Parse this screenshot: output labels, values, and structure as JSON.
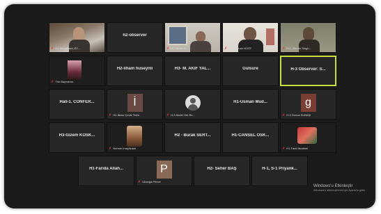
{
  "colors": {
    "background": "#1b1b1b",
    "tile": "#262626",
    "active_border": "#c8de3a",
    "mic_muted": "#e03a3a"
  },
  "rows": [
    [
      {
        "name": "",
        "footer": "H1-Mozaffarov-EY..."
      },
      {
        "name": "h2-observer",
        "footer": ""
      },
      {
        "name": "",
        "footer": "H2-Nilüfer Er..."
      },
      {
        "name": "",
        "footer": "Conference HOST"
      },
      {
        "name": "",
        "footer": "H-2_Vikram Singh..."
      }
    ],
    [
      {
        "name": "",
        "footer": "The Baynamor"
      },
      {
        "name": "H2-ilham huseynli",
        "footer": ""
      },
      {
        "name": "H3- M. AKİF YAL...",
        "footer": ""
      },
      {
        "name": "Gulsure",
        "footer": ""
      },
      {
        "name": "H-3 Observer: S...",
        "footer": ""
      }
    ],
    [
      {
        "name": "Hall-1. CONFER...",
        "footer": ""
      },
      {
        "name": "",
        "footer": "H2-İlknur Çevik Tekin",
        "initial": "İ"
      },
      {
        "name": "",
        "footer": "H-3 Abdel Gül Öz..."
      },
      {
        "name": "H1-Usman Mud...",
        "footer": ""
      },
      {
        "name": "",
        "footer": "H-3 Gonca SUBAŞI",
        "initial": "g"
      }
    ],
    [
      {
        "name": "H3-Gizem KÖSK...",
        "footer": ""
      },
      {
        "name": "",
        "footer": "Nermin İmaylizade"
      },
      {
        "name": "H2 - Burak SERT...",
        "footer": ""
      },
      {
        "name": "H1-CANSEL OSK...",
        "footer": ""
      },
      {
        "name": "",
        "footer": "H1-Farid İbrahimi"
      }
    ],
    [
      {
        "name": "H1-Farida Allah...",
        "footer": ""
      },
      {
        "name": "",
        "footer": "Ubaoga Prince",
        "initial": "P"
      },
      {
        "name": "H2- Seher BAŞ",
        "footer": ""
      },
      {
        "name": "H-1, S-1 Priyank...",
        "footer": ""
      }
    ]
  ],
  "watermark": {
    "title": "Windows'u Etkinleştir",
    "subtitle": "Windows'u etkinleştirmek için Ayarlar'a gidin."
  }
}
